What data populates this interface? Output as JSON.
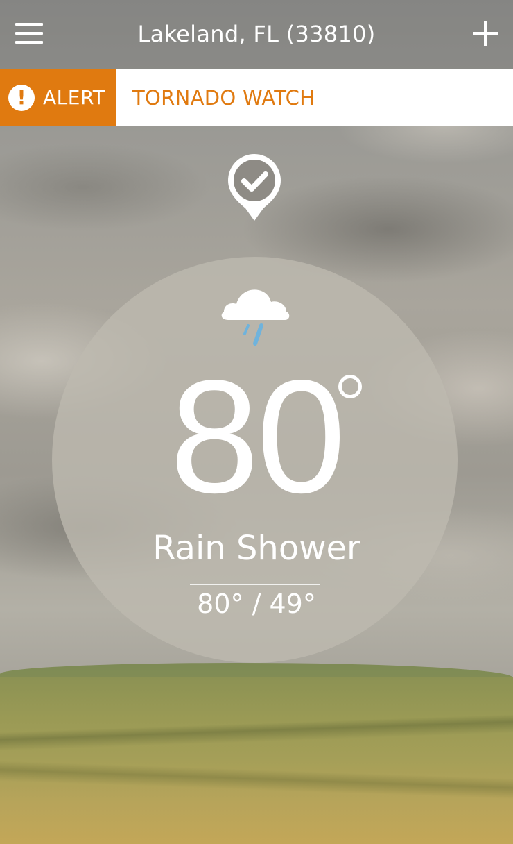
{
  "header": {
    "location": "Lakeland, FL (33810)",
    "menu_icon": "hamburger-menu-icon",
    "add_icon": "plus-icon"
  },
  "alert": {
    "tag_label": "ALERT",
    "tag_icon": "exclamation-icon",
    "message": "TORNADO WATCH",
    "color": "#e07a10"
  },
  "location_pin": {
    "icon": "location-pin-check-icon"
  },
  "current": {
    "condition_icon": "rain-cloud-icon",
    "temperature": "80",
    "condition": "Rain Shower",
    "high_low": "80° / 49°"
  }
}
